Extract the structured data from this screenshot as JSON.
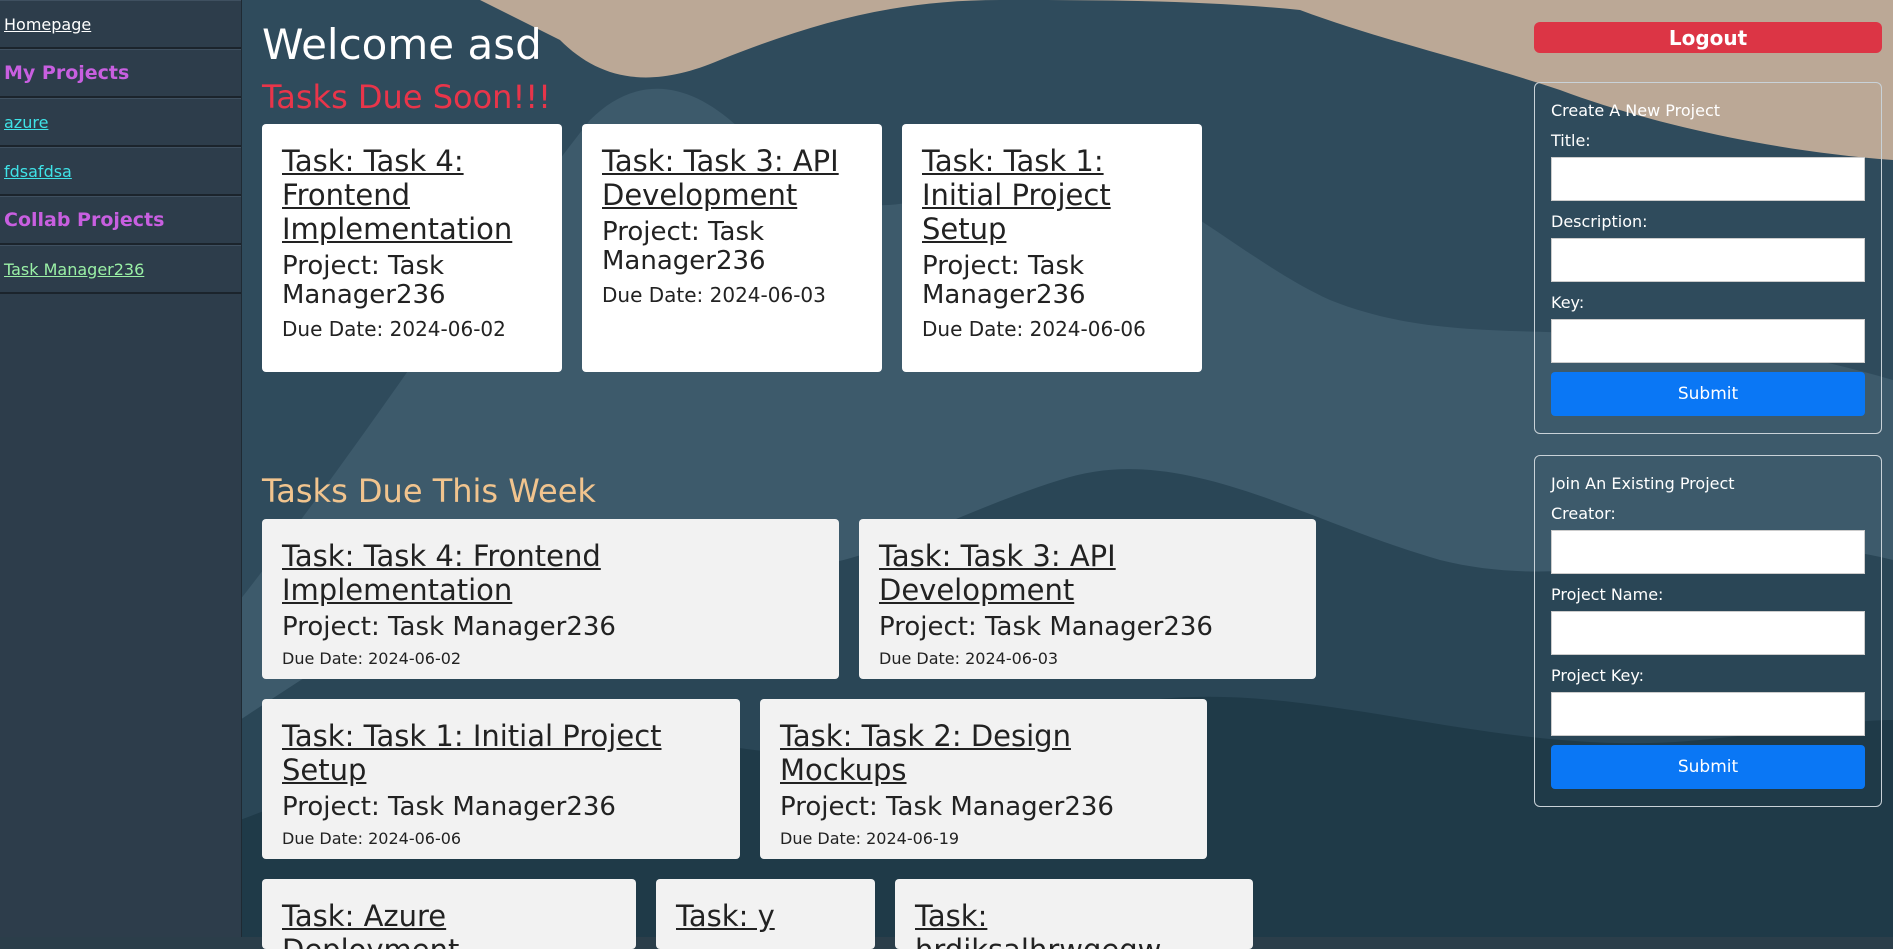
{
  "sidebar": {
    "items": [
      {
        "label": "Homepage",
        "kind": "link"
      },
      {
        "label": "My Projects",
        "kind": "heading"
      },
      {
        "label": "azure",
        "kind": "link"
      },
      {
        "label": "fdsafdsa",
        "kind": "link"
      },
      {
        "label": "Collab Projects",
        "kind": "heading"
      },
      {
        "label": "Task Manager236",
        "kind": "link"
      }
    ]
  },
  "main": {
    "welcome": "Welcome asd",
    "soon_heading": "Tasks Due Soon!!!",
    "soon_tasks": [
      {
        "title": "Task: Task 4: Frontend Implementation",
        "project": "Project: Task Manager236",
        "due": "Due Date: 2024-06-02"
      },
      {
        "title": "Task: Task 3: API Development",
        "project": "Project: Task Manager236",
        "due": "Due Date: 2024-06-03"
      },
      {
        "title": "Task: Task 1: Initial Project Setup",
        "project": "Project: Task Manager236",
        "due": "Due Date: 2024-06-06"
      }
    ],
    "week_heading": "Tasks Due This Week",
    "week_tasks": [
      {
        "title": "Task: Task 4: Frontend Implementation",
        "project": "Project: Task Manager236",
        "due": "Due Date: 2024-06-02"
      },
      {
        "title": "Task: Task 3: API Development",
        "project": "Project: Task Manager236",
        "due": "Due Date: 2024-06-03"
      },
      {
        "title": "Task: Task 1: Initial Project Setup",
        "project": "Project: Task Manager236",
        "due": "Due Date: 2024-06-06"
      },
      {
        "title": "Task: Task 2: Design Mockups",
        "project": "Project: Task Manager236",
        "due": "Due Date: 2024-06-19"
      },
      {
        "title": "Task: Azure Deployment",
        "project": "",
        "due": ""
      },
      {
        "title": "Task: y",
        "project": "",
        "due": ""
      },
      {
        "title": "Task: hrdjksalhrwqeqw",
        "project": "",
        "due": ""
      }
    ]
  },
  "right": {
    "logout_label": "Logout",
    "create": {
      "title": "Create A New Project",
      "title_label": "Title:",
      "description_label": "Description:",
      "key_label": "Key:",
      "submit_label": "Submit"
    },
    "join": {
      "title": "Join An Existing Project",
      "creator_label": "Creator:",
      "project_name_label": "Project Name:",
      "project_key_label": "Project Key:",
      "submit_label": "Submit"
    }
  },
  "colors": {
    "sidebar_bg": "#2d3d4b",
    "heading_purple": "#c85fe0",
    "link_cyan": "#3fe3e8",
    "link_green": "#9af0a6",
    "soon_red": "#e8354a",
    "week_orange": "#f1c48e",
    "logout_red": "#dc3545",
    "submit_blue": "#0a77f5"
  }
}
